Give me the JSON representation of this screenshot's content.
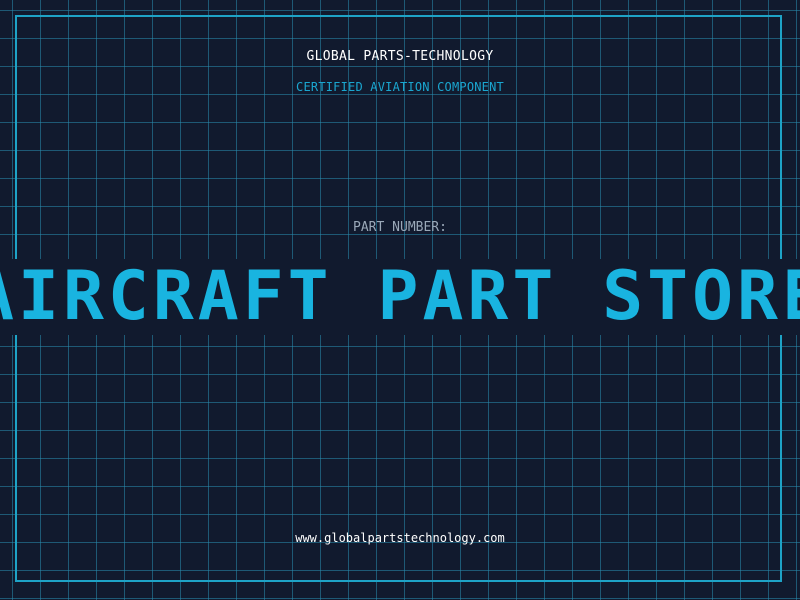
{
  "header": {
    "brand": "GLOBAL PARTS-TECHNOLOGY",
    "subtitle": "CERTIFIED AVIATION COMPONENT"
  },
  "part": {
    "label": "PART NUMBER:",
    "value": "AIRCRAFT PART STORE"
  },
  "footer": {
    "website": "www.globalpartstechnology.com"
  },
  "colors": {
    "background": "#111a2e",
    "grid": "#288caf",
    "frame": "#1ea3c7",
    "accent": "#19b4e0",
    "label": "#9aa8b8",
    "text": "#ffffff"
  }
}
